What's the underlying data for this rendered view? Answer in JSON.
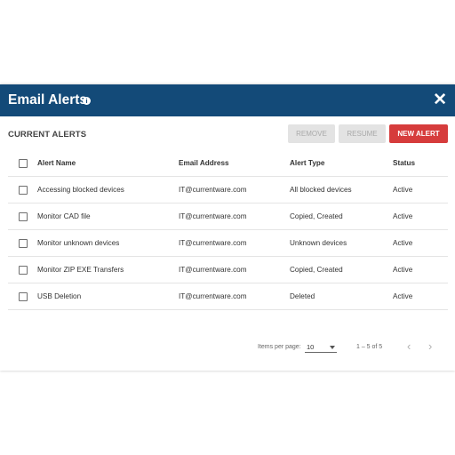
{
  "dialog": {
    "title": "Email Alerts",
    "info_icon": "i",
    "close_icon": "✕"
  },
  "toolbar": {
    "section_title": "CURRENT ALERTS",
    "remove_label": "REMOVE",
    "resume_label": "RESUME",
    "new_alert_label": "NEW ALERT"
  },
  "table": {
    "headers": {
      "name": "Alert Name",
      "email": "Email Address",
      "type": "Alert Type",
      "status": "Status"
    },
    "rows": [
      {
        "name": "Accessing blocked devices",
        "email": "IT@currentware.com",
        "type": "All blocked devices",
        "status": "Active"
      },
      {
        "name": "Monitor CAD file",
        "email": "IT@currentware.com",
        "type": "Copied, Created",
        "status": "Active"
      },
      {
        "name": "Monitor unknown devices",
        "email": "IT@currentware.com",
        "type": "Unknown devices",
        "status": "Active"
      },
      {
        "name": "Monitor ZIP EXE Transfers",
        "email": "IT@currentware.com",
        "type": "Copied, Created",
        "status": "Active"
      },
      {
        "name": "USB Deletion",
        "email": "IT@currentware.com",
        "type": "Deleted",
        "status": "Active"
      }
    ]
  },
  "paginator": {
    "items_per_page_label": "Items per page:",
    "items_per_page_value": "10",
    "range": "1 – 5 of 5",
    "prev_icon": "chevron-left-icon",
    "next_icon": "chevron-right-icon"
  },
  "colors": {
    "header_bg": "#134a78",
    "new_alert_bg": "#d63c3c",
    "disabled_bg": "#e3e3e3"
  }
}
